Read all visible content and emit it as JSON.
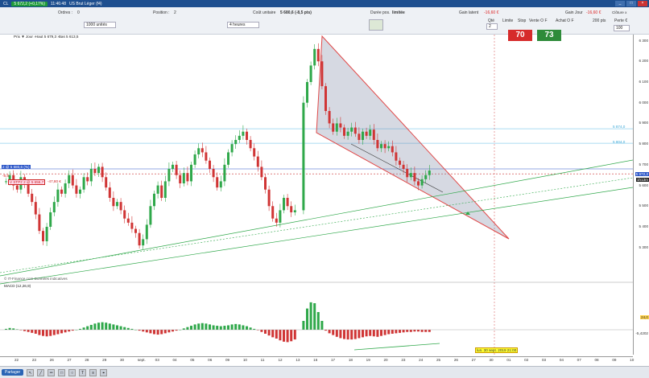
{
  "titlebar": {
    "symbol": "CL",
    "price": "5 672,2 (+0,17%)",
    "time": "11:46:48",
    "instrument": "US Brut Léger (f4)"
  },
  "orders": {
    "ordres_label": "Ordres :",
    "ordres_value": "0",
    "position_label": "Position :",
    "position_value": "2",
    "cout_label": "Coût unitaire",
    "cout_value": "5 680,6 (-8,5 pts)",
    "duree_label": "Durée pos.",
    "duree_value": "limitée",
    "gain_latent_label": "Gain latent",
    "gain_latent_value": "-16,60 €",
    "gain_jour_label": "Gain Jour",
    "gain_jour_value": "-16,60 €",
    "qty_value": "1000 unités",
    "timeframe_value": "4 heures",
    "qte_label": "Qté",
    "qte_value": "2",
    "limite_label": "Limite",
    "stop_label": "Stop",
    "vente_label": "Vente O F",
    "vente_value": "70",
    "achat_label": "Achat O F",
    "achat_value": "73",
    "pts_label": "200 pts",
    "perte_label": "Perte €",
    "perte_value": "100",
    "cloture_label": "Clôture x"
  },
  "chart": {
    "info_line": "Prix ▼  Jour  ›Haut 5 679,3  ›Bas 5 613,5",
    "position_tag": "2 @ 5 680,6 (%)",
    "loss_tag": "-8,8",
    "stop_tag": "V STP≠ 2 @ 5 656,7",
    "stop_loss": "-47,80 €",
    "level_tag_1": "5 874,0",
    "level_tag_2": "5 804,0",
    "price_tag": "5 672,2",
    "time_tag": "1h13m",
    "watermark": "© IT-Finance.com Données indicatives",
    "macd_label": "MACD (12,26,9)",
    "macd_val1": "24,0",
    "macd_val2": "-5,4202",
    "cursor_date": "lun. 30 sept. 2019 21:00"
  },
  "yaxis": [
    "6 300",
    "6 200",
    "6 100",
    "6 000",
    "5 900",
    "5 800",
    "5 700",
    "5 600",
    "5 500",
    "5 400",
    "5 300"
  ],
  "xaxis": [
    "22",
    "23",
    "26",
    "27",
    "28",
    "29",
    "30",
    "sept.",
    "03",
    "04",
    "05",
    "06",
    "09",
    "10",
    "11",
    "12",
    "13",
    "16",
    "17",
    "18",
    "19",
    "20",
    "23",
    "24",
    "25",
    "26",
    "27",
    "30",
    "01",
    "02",
    "03",
    "04",
    "07",
    "08",
    "09",
    "10"
  ],
  "statusbar": {
    "share_label": "Partager"
  },
  "colors": {
    "up": "#2fa84a",
    "down": "#d03535",
    "title": "#1e4f8f",
    "sell": "#d62b2b",
    "buy": "#2e8b3a"
  },
  "chart_data": {
    "type": "candlestick",
    "ylim": [
      5260,
      6310
    ],
    "closes": [
      5620,
      5650,
      5600,
      5580,
      5640,
      5610,
      5560,
      5520,
      5460,
      5380,
      5330,
      5400,
      5470,
      5520,
      5580,
      5560,
      5610,
      5650,
      5600,
      5560,
      5580,
      5640,
      5620,
      5680,
      5660,
      5690,
      5640,
      5590,
      5540,
      5500,
      5520,
      5480,
      5440,
      5420,
      5390,
      5370,
      5310,
      5340,
      5410,
      5500,
      5560,
      5600,
      5540,
      5620,
      5680,
      5700,
      5650,
      5610,
      5660,
      5620,
      5700,
      5750,
      5780,
      5760,
      5720,
      5680,
      5640,
      5590,
      5620,
      5700,
      5760,
      5800,
      5820,
      5840,
      5860,
      5820,
      5780,
      5740,
      5690,
      5640,
      5580,
      5500,
      5440,
      5420,
      5480,
      5540,
      5500,
      5470,
      5480,
      6000,
      6100,
      6180,
      6260,
      6200,
      6080,
      5960,
      5900,
      5860,
      5900,
      5880,
      5840,
      5860,
      5880,
      5850,
      5820,
      5860,
      5840,
      5870,
      5820,
      5780,
      5800,
      5780,
      5790,
      5760,
      5720,
      5700,
      5680,
      5640,
      5660,
      5620,
      5600,
      5630,
      5650,
      5672
    ],
    "macd": [
      2,
      4,
      3,
      1,
      -1,
      -3,
      -5,
      -7,
      -9,
      -12,
      -14,
      -15,
      -14,
      -12,
      -10,
      -8,
      -6,
      -4,
      -2,
      0,
      2,
      5,
      8,
      11,
      14,
      16,
      17,
      16,
      14,
      12,
      10,
      8,
      6,
      4,
      2,
      0,
      -2,
      -4,
      -6,
      -8,
      -10,
      -11,
      -10,
      -8,
      -6,
      -4,
      -2,
      0,
      3,
      6,
      9,
      12,
      14,
      15,
      14,
      12,
      10,
      9,
      8,
      9,
      10,
      12,
      13,
      12,
      10,
      8,
      5,
      2,
      -1,
      -5,
      -9,
      -13,
      -17,
      -20,
      -24,
      -27,
      -28,
      -26,
      -22,
      20,
      48,
      62,
      60,
      40,
      20,
      -2,
      -8,
      -12,
      -16,
      -19,
      -21,
      -22,
      -22,
      -21,
      -19,
      -17,
      -15,
      -14,
      -15,
      -16,
      -14,
      -12,
      -10,
      -9,
      -8,
      -7,
      -6,
      -5,
      -5,
      -4,
      -4,
      -5,
      -5,
      -5
    ]
  }
}
